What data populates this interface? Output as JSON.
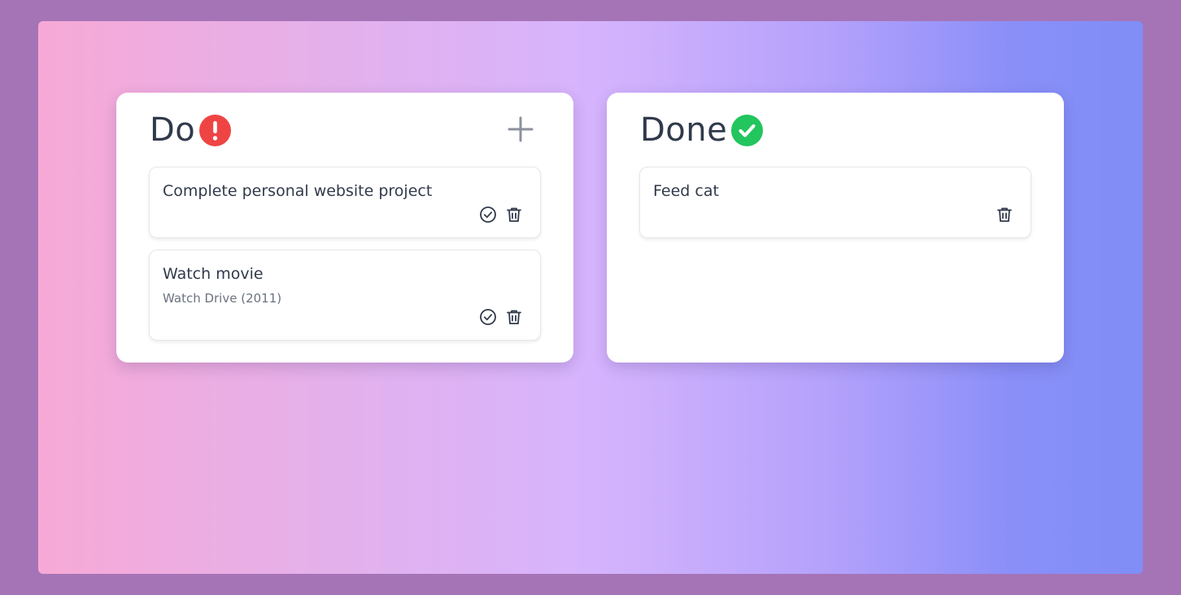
{
  "colors": {
    "frame_background": "#a574b7",
    "gradient_start": "#f7a9d6",
    "gradient_mid": "#d6b4fd",
    "gradient_end": "#7f8ef6",
    "alert": "#ef4444",
    "success": "#22c55e",
    "text": "#313a4b",
    "muted_text": "#6b7280"
  },
  "columns": {
    "do": {
      "title": "Do",
      "status_icon": "exclamation-circle-icon",
      "add_icon": "plus-icon",
      "cards": [
        {
          "title": "Complete personal website project",
          "subtitle": "",
          "actions": [
            "check-circle-icon",
            "trash-icon"
          ]
        },
        {
          "title": "Watch movie",
          "subtitle": "Watch Drive (2011)",
          "actions": [
            "check-circle-icon",
            "trash-icon"
          ]
        }
      ]
    },
    "done": {
      "title": "Done",
      "status_icon": "check-circle-filled-icon",
      "cards": [
        {
          "title": "Feed cat",
          "subtitle": "",
          "actions": [
            "trash-icon"
          ]
        }
      ]
    }
  }
}
